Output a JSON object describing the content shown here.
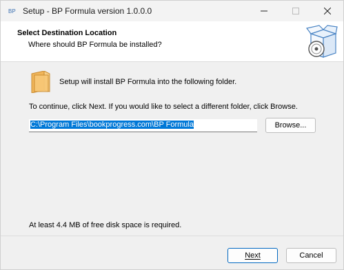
{
  "window": {
    "title": "Setup - BP Formula version 1.0.0.0",
    "icon": "bp-app-icon",
    "controls": [
      "minimize-icon",
      "maximize-icon",
      "close-icon"
    ]
  },
  "header": {
    "title": "Select Destination Location",
    "subtitle": "Where should BP Formula be installed?",
    "image": "installer-box-disc-icon"
  },
  "main": {
    "install_text": "Setup will install BP Formula into the following folder.",
    "continue_text": "To continue, click Next. If you would like to select a different folder, click Browse.",
    "path_value": "C:\\Program Files\\bookprogress.com\\BP Formula",
    "browse_label": "Browse...",
    "disk_space_text": "At least 4.4 MB of free disk space is required.",
    "folder_icon": "folder-icon"
  },
  "footer": {
    "next_label": "Next",
    "cancel_label": "Cancel"
  },
  "colors": {
    "accent": "#0078d7",
    "header_bg": "#ffffff",
    "dialog_bg": "#f0f0f0"
  }
}
